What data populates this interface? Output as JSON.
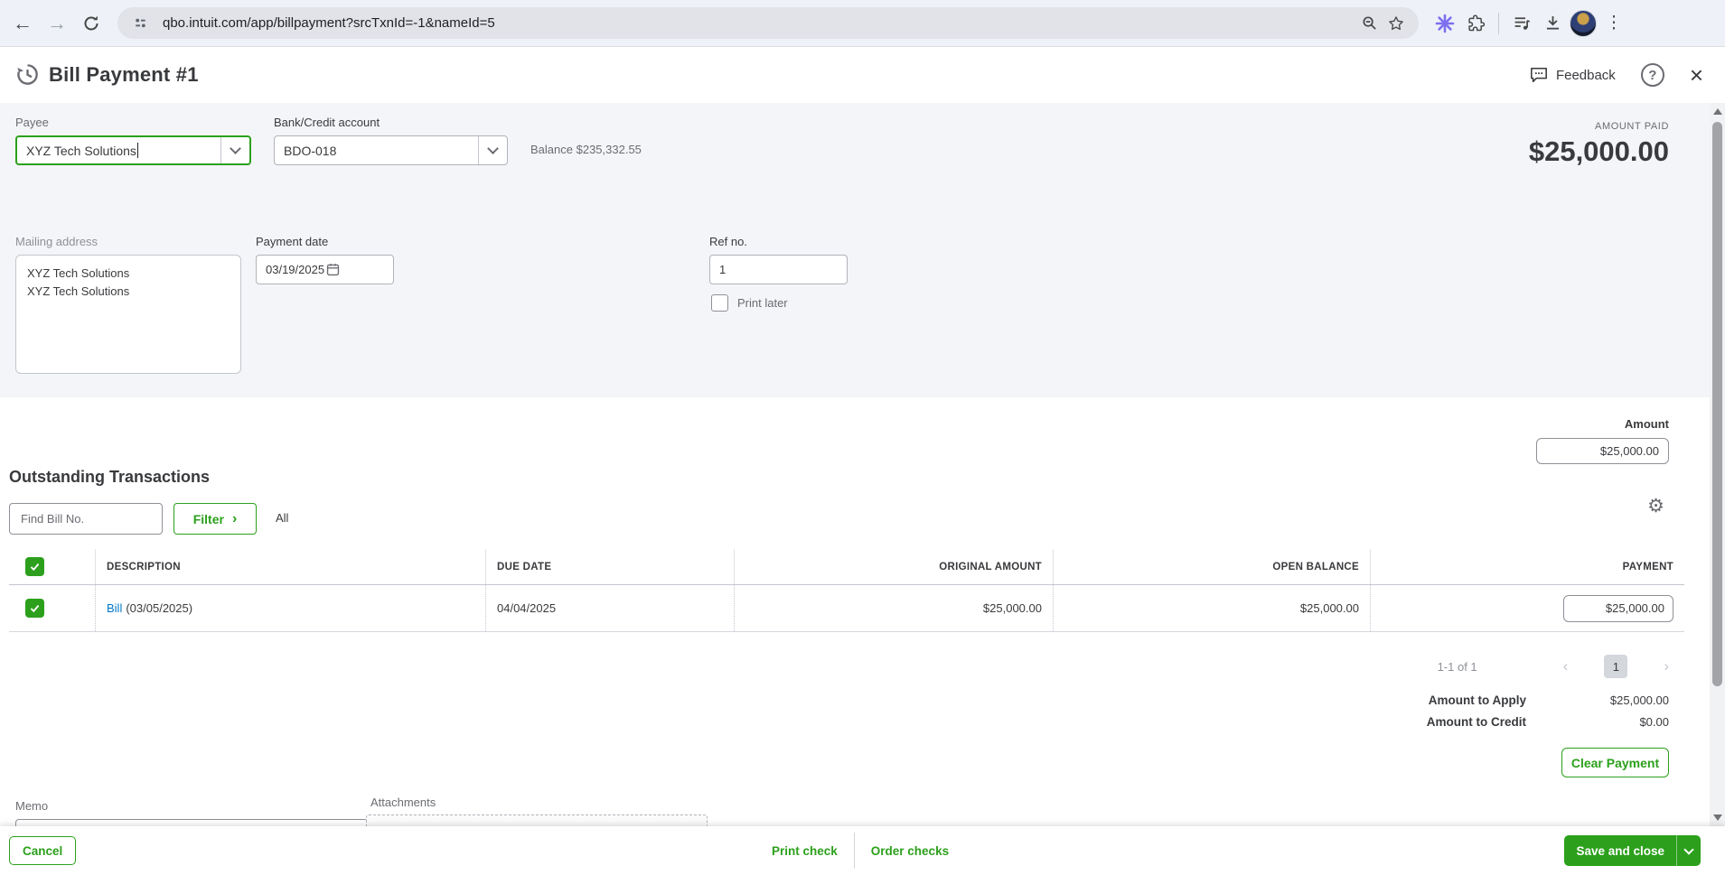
{
  "browser": {
    "url": "qbo.intuit.com/app/billpayment?srcTxnId=-1&nameId=5",
    "icons": {
      "back": "←",
      "forward": "→",
      "menu": "⋮"
    }
  },
  "header": {
    "title": "Bill Payment #1",
    "feedback_label": "Feedback",
    "icons": {
      "help": "?",
      "close": "×"
    }
  },
  "amount_paid": {
    "label": "AMOUNT PAID",
    "value": "$25,000.00"
  },
  "form": {
    "payee": {
      "label": "Payee",
      "value": "XYZ Tech Solutions"
    },
    "bank_account": {
      "label": "Bank/Credit account",
      "value": "BDO-018",
      "balance_label": "Balance",
      "balance_value": "$235,332.55"
    },
    "mailing_address": {
      "label": "Mailing address",
      "value": "XYZ Tech Solutions\nXYZ Tech Solutions"
    },
    "payment_date": {
      "label": "Payment date",
      "value": "03/19/2025"
    },
    "ref_no": {
      "label": "Ref no.",
      "value": "1"
    },
    "print_later_label": "Print later",
    "amount": {
      "label": "Amount",
      "value": "$25,000.00"
    }
  },
  "transactions": {
    "title": "Outstanding Transactions",
    "find_placeholder": "Find Bill No.",
    "filter_label": "Filter",
    "filter_chevron": "›",
    "filter_all": "All",
    "gear_icon": "⚙",
    "table": {
      "headers": [
        "DESCRIPTION",
        "DUE DATE",
        "ORIGINAL AMOUNT",
        "OPEN BALANCE",
        "PAYMENT"
      ],
      "rows": [
        {
          "description_link": "Bill",
          "description_date": "(03/05/2025)",
          "due_date": "04/04/2025",
          "original_amount": "$25,000.00",
          "open_balance": "$25,000.00",
          "payment": "$25,000.00"
        }
      ]
    },
    "pagination": {
      "range": "1-1 of 1",
      "prev": "‹",
      "page": "1",
      "next": "›"
    },
    "amount_to_apply_label": "Amount to Apply",
    "amount_to_apply_value": "$25,000.00",
    "amount_to_credit_label": "Amount to Credit",
    "amount_to_credit_value": "$0.00",
    "clear_payment_label": "Clear Payment"
  },
  "memo": {
    "label": "Memo"
  },
  "attachments": {
    "label": "Attachments"
  },
  "footer": {
    "cancel": "Cancel",
    "print_check": "Print check",
    "order_checks": "Order checks",
    "save_and_close": "Save and close"
  },
  "colors": {
    "qbo_green": "#2ca01c",
    "link_blue": "#0077c5",
    "dark_text": "#393a3d"
  }
}
